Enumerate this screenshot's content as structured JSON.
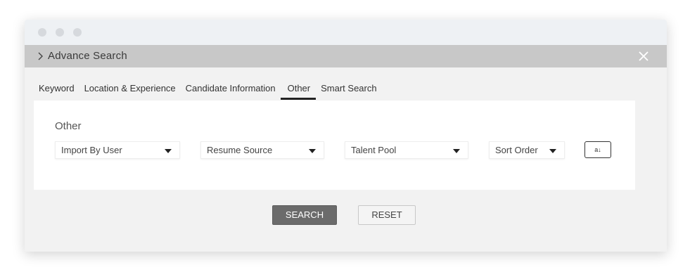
{
  "header": {
    "title": "Advance Search"
  },
  "tabs": [
    {
      "label": "Keyword"
    },
    {
      "label": "Location & Experience"
    },
    {
      "label": "Candidate Information"
    },
    {
      "label": "Other"
    },
    {
      "label": "Smart Search"
    }
  ],
  "active_tab": "Other",
  "panel": {
    "title": "Other",
    "filters": [
      {
        "label": "Import By User"
      },
      {
        "label": "Resume Source"
      },
      {
        "label": "Talent Pool"
      },
      {
        "label": "Sort Order"
      }
    ],
    "sort_icon_text": "a↓"
  },
  "actions": {
    "search_label": "SEARCH",
    "reset_label": "RESET"
  },
  "colors": {
    "header_bg": "#c8c8c8",
    "search_btn": "#6b6b6b",
    "window_bg": "#f2f2f2"
  }
}
